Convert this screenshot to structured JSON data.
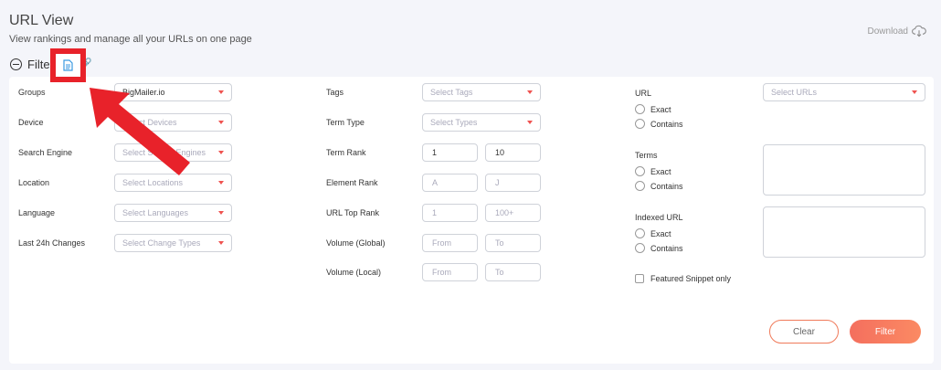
{
  "header": {
    "title": "URL View",
    "subtitle": "View rankings and manage all your URLs on one page",
    "download_label": "Download"
  },
  "filter_toggle": {
    "label": "Filter"
  },
  "left_col": {
    "groups": {
      "label": "Groups",
      "value": "BigMailer.io"
    },
    "device": {
      "label": "Device",
      "placeholder": "Select Devices"
    },
    "search_engine": {
      "label": "Search Engine",
      "placeholder": "Select Search Engines"
    },
    "location": {
      "label": "Location",
      "placeholder": "Select Locations"
    },
    "language": {
      "label": "Language",
      "placeholder": "Select Languages"
    },
    "changes": {
      "label": "Last 24h Changes",
      "placeholder": "Select Change Types"
    }
  },
  "mid_col": {
    "tags": {
      "label": "Tags",
      "placeholder": "Select Tags"
    },
    "term_type": {
      "label": "Term Type",
      "placeholder": "Select Types"
    },
    "term_rank": {
      "label": "Term Rank",
      "from": "1",
      "to": "10"
    },
    "element_rank": {
      "label": "Element Rank",
      "from": "A",
      "to": "J"
    },
    "url_top_rank": {
      "label": "URL Top Rank",
      "from": "1",
      "to": "100+"
    },
    "volume_global": {
      "label": "Volume (Global)",
      "from": "From",
      "to": "To"
    },
    "volume_local": {
      "label": "Volume (Local)",
      "from": "From",
      "to": "To"
    }
  },
  "right_col": {
    "url": {
      "label": "URL",
      "placeholder": "Select URLs",
      "exact": "Exact",
      "contains": "Contains"
    },
    "terms": {
      "label": "Terms",
      "exact": "Exact",
      "contains": "Contains"
    },
    "indexed_url": {
      "label": "Indexed URL",
      "exact": "Exact",
      "contains": "Contains"
    },
    "featured": {
      "label": "Featured Snippet only"
    }
  },
  "actions": {
    "clear": "Clear",
    "filter": "Filter"
  },
  "colors": {
    "accent": "#f46f5e",
    "highlight": "#e8222a"
  }
}
